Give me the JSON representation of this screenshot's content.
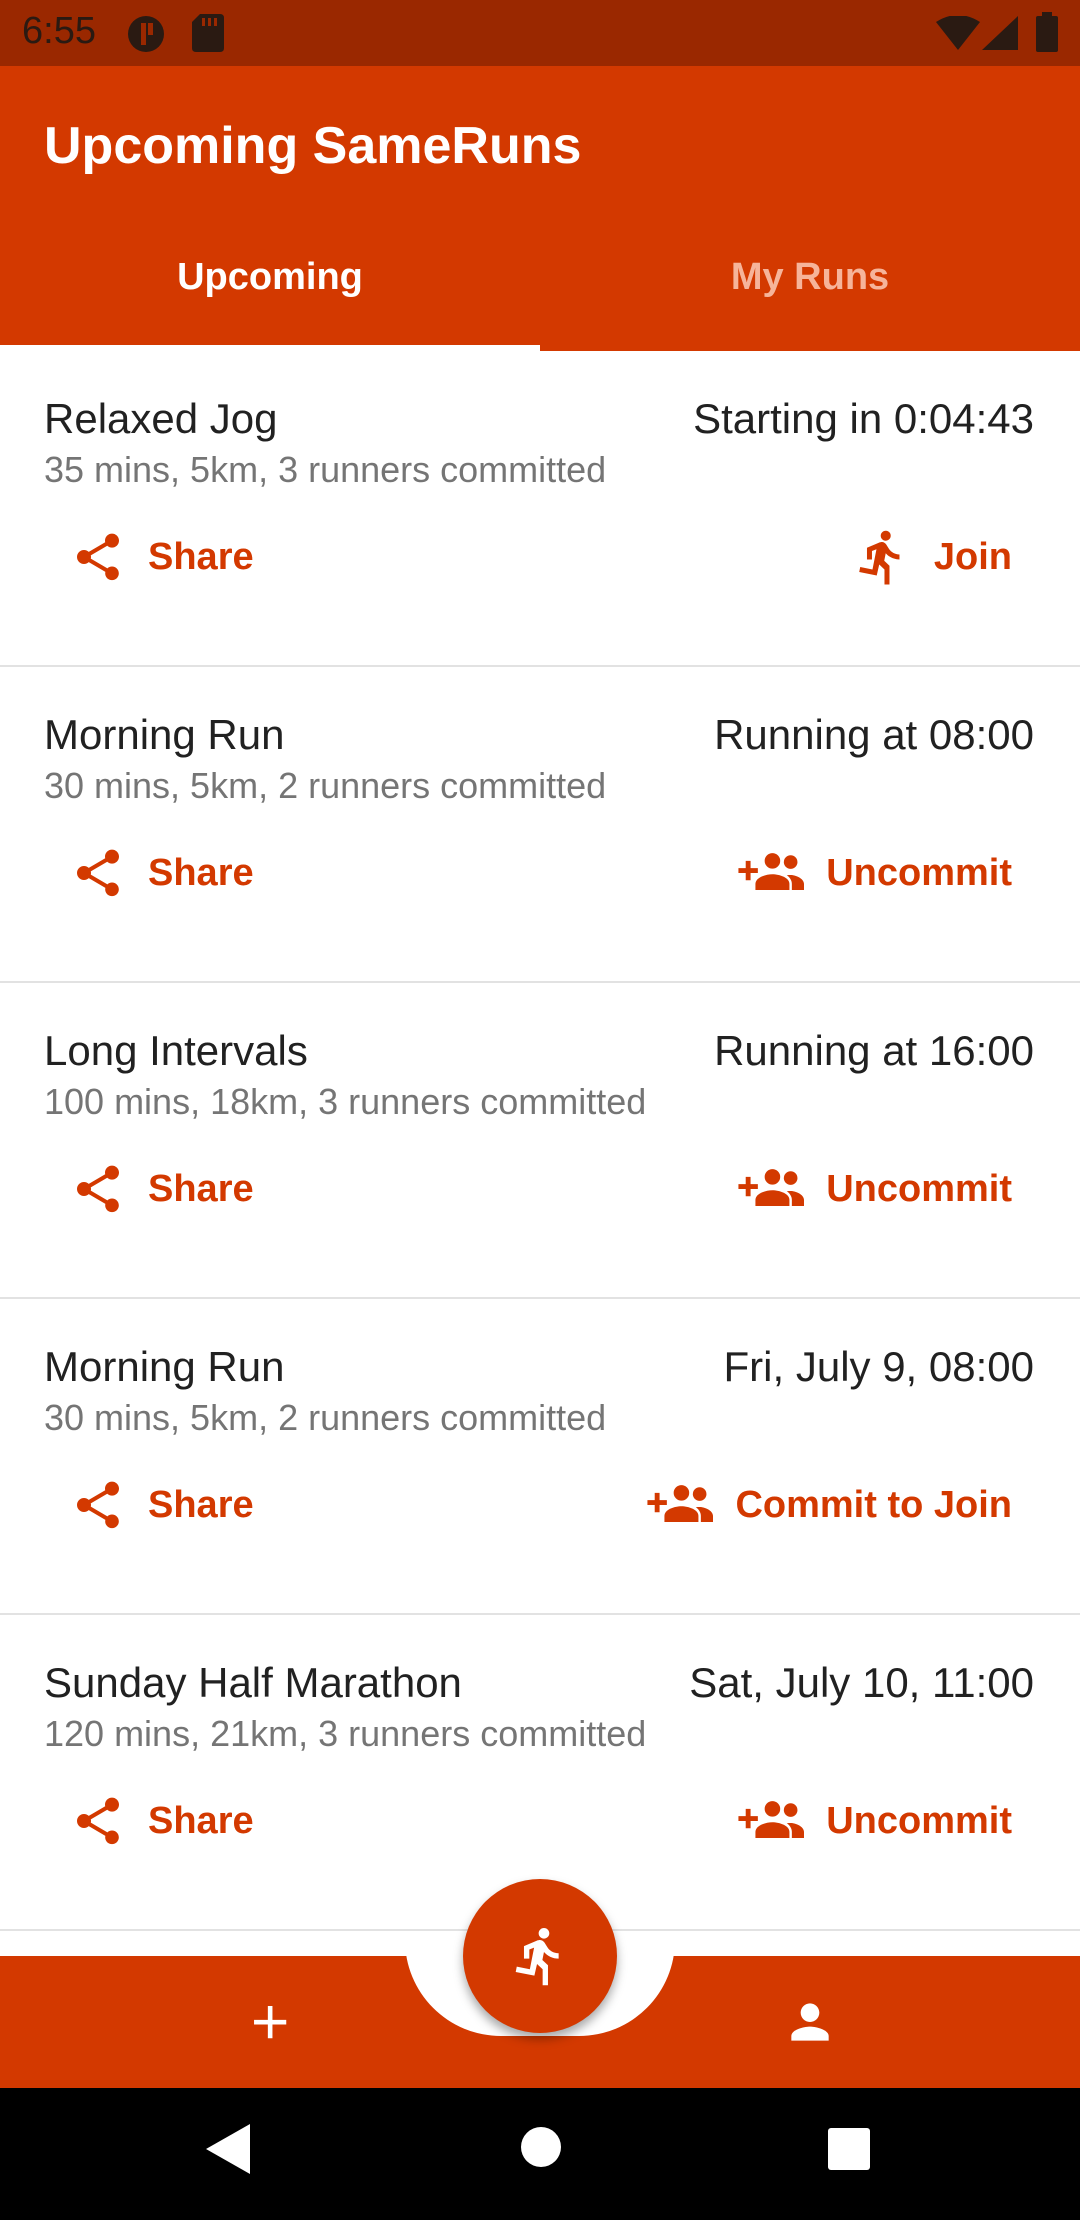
{
  "status_bar": {
    "time": "6:55",
    "icons": [
      "notification-icon",
      "sd-card-icon",
      "wifi-icon",
      "signal-icon",
      "battery-icon"
    ]
  },
  "app_bar": {
    "title": "Upcoming SameRuns",
    "tabs": [
      {
        "label": "Upcoming",
        "selected": true
      },
      {
        "label": "My Runs",
        "selected": false
      }
    ]
  },
  "runs": [
    {
      "title": "Relaxed Jog",
      "when": "Starting in 0:04:43",
      "details": "35 mins, 5km, 3 runners committed",
      "share_label": "Share",
      "action_label": "Join",
      "action_icon": "run-icon"
    },
    {
      "title": "Morning Run",
      "when": "Running at 08:00",
      "details": "30 mins, 5km, 2 runners committed",
      "share_label": "Share",
      "action_label": "Uncommit",
      "action_icon": "group-add-icon"
    },
    {
      "title": "Long Intervals",
      "when": "Running at 16:00",
      "details": "100 mins, 18km, 3 runners committed",
      "share_label": "Share",
      "action_label": "Uncommit",
      "action_icon": "group-add-icon"
    },
    {
      "title": "Morning Run",
      "when": "Fri, July 9, 08:00",
      "details": "30 mins, 5km, 2 runners committed",
      "share_label": "Share",
      "action_label": "Commit to Join",
      "action_icon": "group-add-icon"
    },
    {
      "title": "Sunday Half Marathon",
      "when": "Sat, July 10, 11:00",
      "details": "120 mins, 21km, 3 runners committed",
      "share_label": "Share",
      "action_label": "Uncommit",
      "action_icon": "group-add-icon"
    }
  ],
  "bottom_bar": {
    "left_icon": "add-icon",
    "fab_icon": "run-icon",
    "right_icon": "person-icon"
  },
  "nav_bar": {
    "icons": [
      "back-icon",
      "home-icon",
      "recents-icon"
    ]
  },
  "colors": {
    "primary": "#d33900",
    "status_bar": "#9a2800",
    "inactive_tab": "#f6b49a"
  }
}
